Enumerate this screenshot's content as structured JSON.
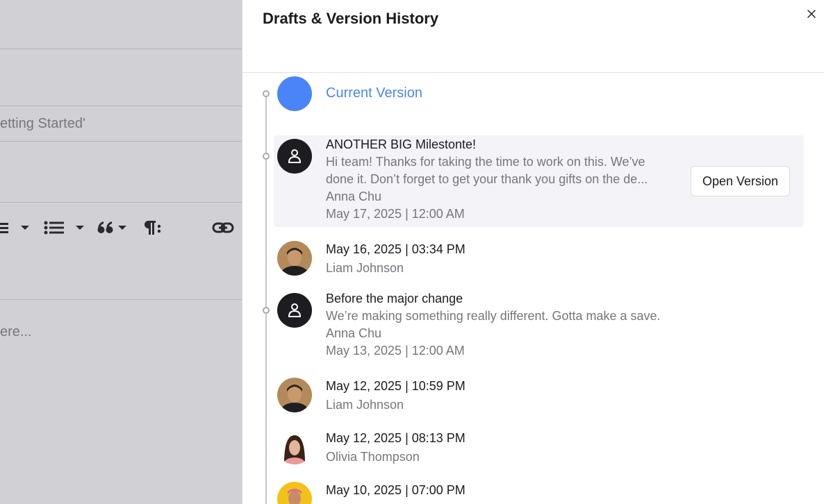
{
  "backdrop": {
    "text_heading": "etting Started'",
    "text_placeholder": "ere...",
    "toolbar_icons": [
      "align-left-icon",
      "bullet-list-icon",
      "quote-icon",
      "paragraph-icon",
      "link-icon"
    ]
  },
  "panel": {
    "title": "Drafts & Version History",
    "close_icon": "close-icon",
    "current_version_label": "Current Version",
    "open_version_label": "Open Version",
    "accent_color": "#4a85f7"
  },
  "versions": [
    {
      "title": "ANOTHER BIG Milestonte!",
      "description": "Hi team! Thanks for taking the time to work on this. We’ve done it. Don’t forget to get your thank you gifts on the de...",
      "author": "Anna Chu",
      "date": "May 17, 2025 | 12:00 AM",
      "avatar": "generic-user-icon",
      "highlighted": true
    },
    {
      "title": "May 16, 2025 | 03:34 PM",
      "author": "Liam Johnson",
      "avatar": "photo"
    },
    {
      "title": "Before the major change",
      "description": "We’re making something really different. Gotta make a save.",
      "author": "Anna Chu",
      "date": "May 13, 2025 | 12:00 AM",
      "avatar": "generic-user-icon"
    },
    {
      "title": "May 12, 2025 | 10:59 PM",
      "author": "Liam Johnson",
      "avatar": "photo"
    },
    {
      "title": "May 12, 2025 | 08:13 PM",
      "author": "Olivia Thompson",
      "avatar": "photo"
    },
    {
      "title": "May 10, 2025 | 07:00 PM",
      "author": "",
      "avatar": "photo"
    }
  ]
}
